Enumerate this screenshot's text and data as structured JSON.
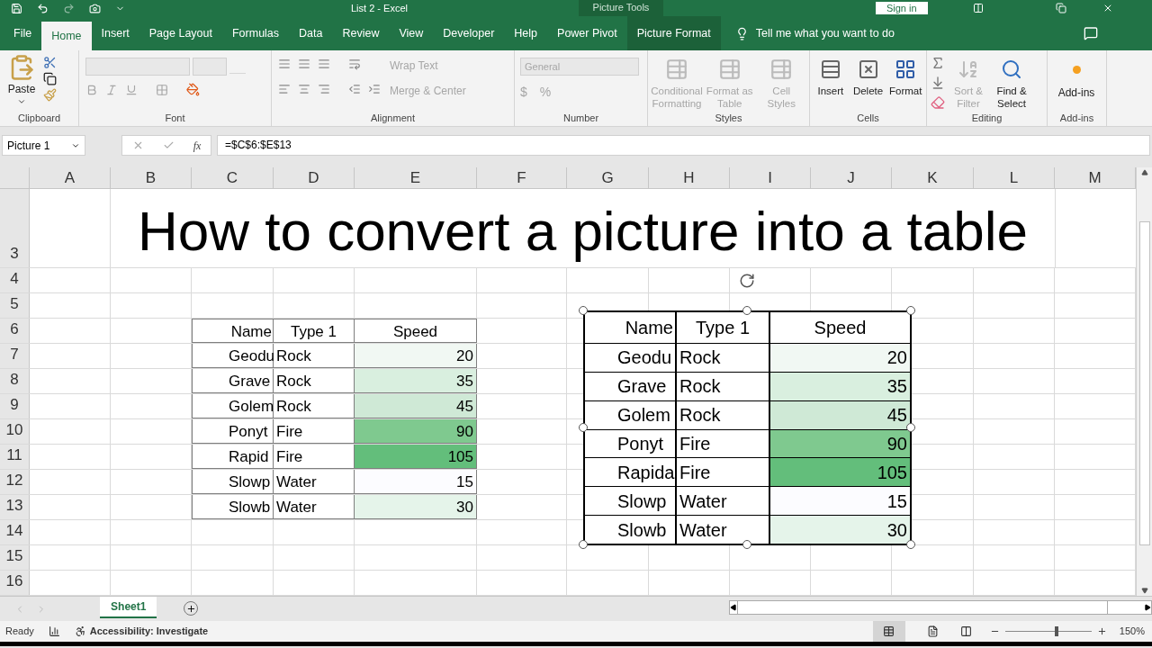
{
  "window": {
    "title": "List 2  -  Excel",
    "context_title": "Picture Tools",
    "sign_in": "Sign in"
  },
  "tabs": [
    {
      "label": "File",
      "selected": false,
      "kind": "tab"
    },
    {
      "label": "Home",
      "selected": true,
      "kind": "tab"
    },
    {
      "label": "Insert",
      "selected": false,
      "kind": "tab"
    },
    {
      "label": "Page Layout",
      "selected": false,
      "kind": "tab"
    },
    {
      "label": "Formulas",
      "selected": false,
      "kind": "tab"
    },
    {
      "label": "Data",
      "selected": false,
      "kind": "tab"
    },
    {
      "label": "Review",
      "selected": false,
      "kind": "tab"
    },
    {
      "label": "View",
      "selected": false,
      "kind": "tab"
    },
    {
      "label": "Developer",
      "selected": false,
      "kind": "tab"
    },
    {
      "label": "Help",
      "selected": false,
      "kind": "tab"
    },
    {
      "label": "Power Pivot",
      "selected": false,
      "kind": "tab"
    },
    {
      "label": "Picture Format",
      "selected": false,
      "kind": "contextual"
    }
  ],
  "tell_me": "Tell me what you want to do",
  "ribbon": {
    "clipboard": {
      "label": "Clipboard",
      "paste": "Paste"
    },
    "font": {
      "label": "Font"
    },
    "alignment": {
      "label": "Alignment",
      "wrap_text": {
        "label": "Wrap Text",
        "disabled": true
      },
      "merge_center": {
        "label": "Merge & Center",
        "disabled": true
      }
    },
    "number": {
      "label": "Number",
      "format": "General",
      "currency": "$",
      "percent": "%"
    },
    "styles": {
      "label": "Styles",
      "items": [
        {
          "label": "Conditional Formatting",
          "disabled": true
        },
        {
          "label": "Format as Table",
          "disabled": true
        },
        {
          "label": "Cell Styles",
          "disabled": true
        }
      ]
    },
    "cells": {
      "label": "Cells",
      "items": [
        {
          "label": "Insert",
          "disabled": false
        },
        {
          "label": "Delete",
          "disabled": false
        },
        {
          "label": "Format",
          "disabled": false
        }
      ]
    },
    "editing": {
      "label": "Editing",
      "items": [
        {
          "label": "Sort & Filter",
          "disabled": true
        },
        {
          "label": "Find & Select",
          "disabled": false
        }
      ]
    },
    "addins": {
      "label": "Add-ins",
      "button": "Add-ins"
    }
  },
  "formula_bar": {
    "name_box": "Picture 1",
    "fx": "fx",
    "formula": "=$C$6:$E$13"
  },
  "sheet": {
    "columns": [
      "A",
      "B",
      "C",
      "D",
      "E",
      "F",
      "G",
      "H",
      "I",
      "J",
      "K",
      "L",
      "M"
    ],
    "row_numbers": [
      "3",
      "4",
      "5",
      "6",
      "7",
      "8",
      "9",
      "10",
      "11",
      "12",
      "13",
      "14",
      "15",
      "16"
    ],
    "title": "How to convert a picture into a table",
    "table": {
      "header": [
        "Name",
        "Type 1",
        "Speed"
      ],
      "rows": [
        {
          "name": "Geodu",
          "type": "Rock",
          "speed": "20",
          "color": "#f1f8f3"
        },
        {
          "name": "Grave",
          "type": "Rock",
          "speed": "35",
          "color": "#d9efdf"
        },
        {
          "name": "Golem",
          "type": "Rock",
          "speed": "45",
          "color": "#cfe9d6"
        },
        {
          "name": "Ponyt",
          "type": "Fire",
          "speed": "90",
          "color": "#7fc98f"
        },
        {
          "name": "Rapid",
          "type": "Fire",
          "speed": "105",
          "color": "#63be7b"
        },
        {
          "name": "Slowp",
          "type": "Water",
          "speed": "15",
          "color": "#fcfcff"
        },
        {
          "name": "Slowb",
          "type": "Water",
          "speed": "30",
          "color": "#e5f4ea"
        }
      ]
    },
    "picture": {
      "selected": true,
      "header": [
        "Name",
        "Type 1",
        "Speed"
      ],
      "rows": [
        {
          "name": "Geodu",
          "type": "Rock",
          "speed": "20",
          "color": "#f1f8f3"
        },
        {
          "name": "Grave",
          "type": "Rock",
          "speed": "35",
          "color": "#d9efdf"
        },
        {
          "name": "Golem",
          "type": "Rock",
          "speed": "45",
          "color": "#cfe9d6"
        },
        {
          "name": "Ponyt",
          "type": "Fire",
          "speed": "90",
          "color": "#7fc98f"
        },
        {
          "name": "Rapida",
          "type": "Fire",
          "speed": "105",
          "color": "#63be7b"
        },
        {
          "name": "Slowp",
          "type": "Water",
          "speed": "15",
          "color": "#fcfcff"
        },
        {
          "name": "Slowb",
          "type": "Water",
          "speed": "30",
          "color": "#e5f4ea"
        }
      ]
    }
  },
  "sheet_tabs": [
    {
      "label": "Sheet1",
      "selected": true
    }
  ],
  "status_bar": {
    "ready": "Ready",
    "accessibility": "Accessibility: Investigate",
    "zoom": "150%",
    "zoom_level": {
      "level": 0.6
    }
  }
}
